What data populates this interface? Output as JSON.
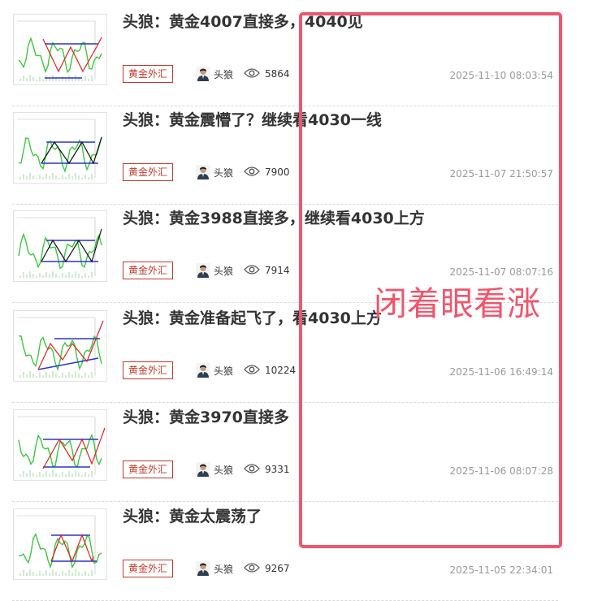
{
  "articles": [
    {
      "title": "头狼：黄金4007直接多，4040见",
      "tag": "黄金外汇",
      "author": "头狼",
      "views": "5864",
      "date": "2025-11-10 08:03:54"
    },
    {
      "title": "头狼：黄金震懵了？继续看4030一线",
      "tag": "黄金外汇",
      "author": "头狼",
      "views": "7900",
      "date": "2025-11-07 21:50:57"
    },
    {
      "title": "头狼：黄金3988直接多，继续看4030上方",
      "tag": "黄金外汇",
      "author": "头狼",
      "views": "7914",
      "date": "2025-11-07 08:07:16"
    },
    {
      "title": "头狼：黄金准备起飞了，看4030上方",
      "tag": "黄金外汇",
      "author": "头狼",
      "views": "10224",
      "date": "2025-11-06 16:49:14"
    },
    {
      "title": "头狼：黄金3970直接多",
      "tag": "黄金外汇",
      "author": "头狼",
      "views": "9331",
      "date": "2025-11-06 08:07:28"
    },
    {
      "title": "头狼：黄金太震荡了",
      "tag": "黄金外汇",
      "author": "头狼",
      "views": "9267",
      "date": "2025-11-05 22:34:01"
    }
  ],
  "annotation": {
    "text": "闭着眼看涨",
    "color": "#f0566c"
  },
  "icons": {
    "views": "eye-icon",
    "avatar": "author-avatar"
  },
  "colors": {
    "tag": "#c0392b",
    "date": "#999999",
    "title": "#333333"
  }
}
